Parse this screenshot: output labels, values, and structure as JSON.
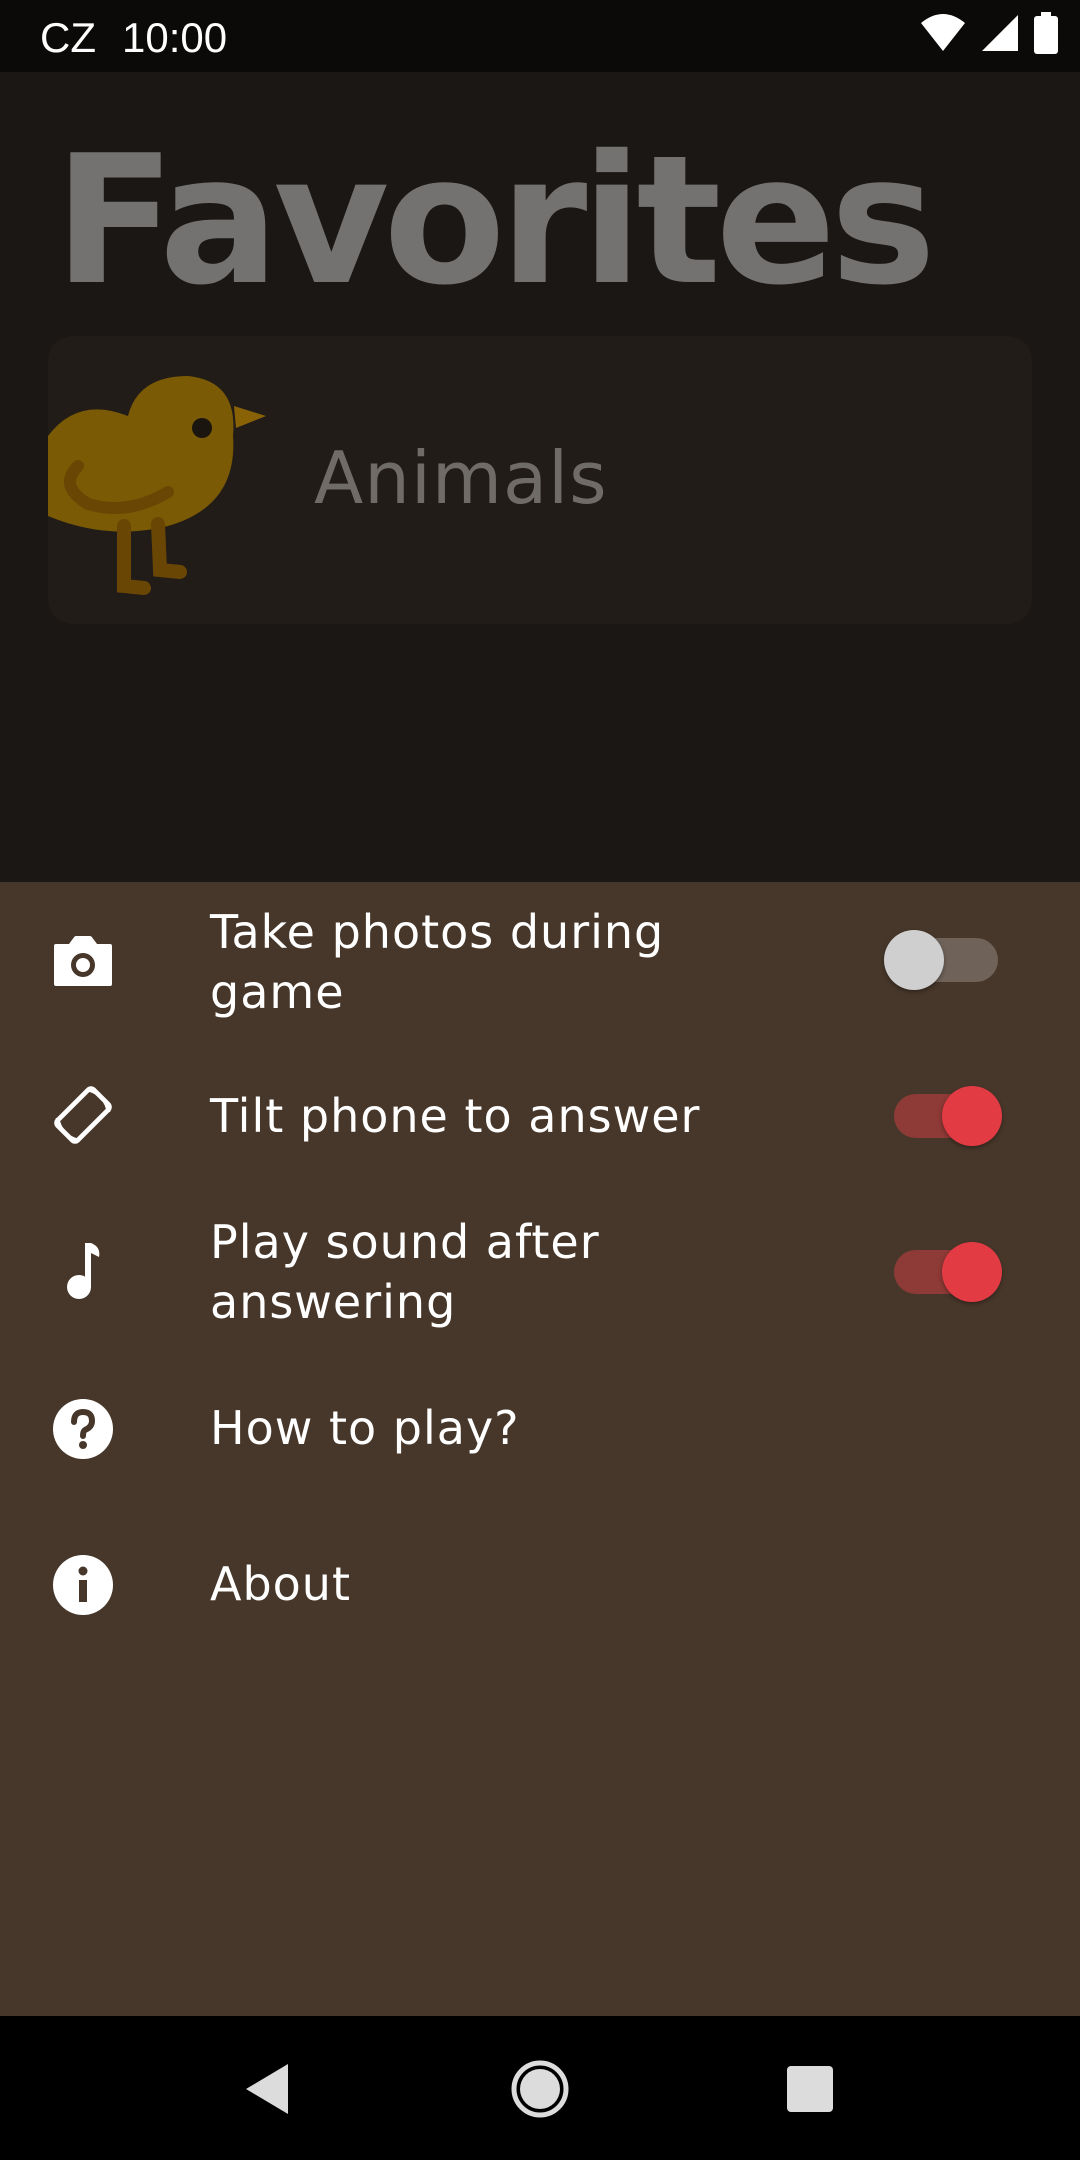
{
  "status_bar": {
    "carrier": "CZ",
    "time": "10:00",
    "icons": [
      "wifi-icon",
      "cellular-signal-icon",
      "battery-icon"
    ]
  },
  "main": {
    "title": "Favorites",
    "category_card": {
      "label": "Animals",
      "image_icon": "chick-icon"
    }
  },
  "settings": {
    "items": [
      {
        "icon": "camera-icon",
        "label": "Take photos during game",
        "has_toggle": true,
        "toggle_on": false
      },
      {
        "icon": "screen-rotation-icon",
        "label": "Tilt phone to answer",
        "has_toggle": true,
        "toggle_on": true
      },
      {
        "icon": "music-note-icon",
        "label": "Play sound after answering",
        "has_toggle": true,
        "toggle_on": true
      },
      {
        "icon": "help-circle-icon",
        "label": "How to play?",
        "has_toggle": false
      },
      {
        "icon": "info-circle-icon",
        "label": "About",
        "has_toggle": false
      }
    ]
  },
  "nav_bar": {
    "buttons": [
      "back-icon",
      "home-icon",
      "recents-icon"
    ]
  },
  "colors": {
    "sheet_background": "#47372a",
    "toggle_on": "#e23b44",
    "toggle_off_thumb": "#cfcfcf",
    "title_color": "#747271"
  }
}
